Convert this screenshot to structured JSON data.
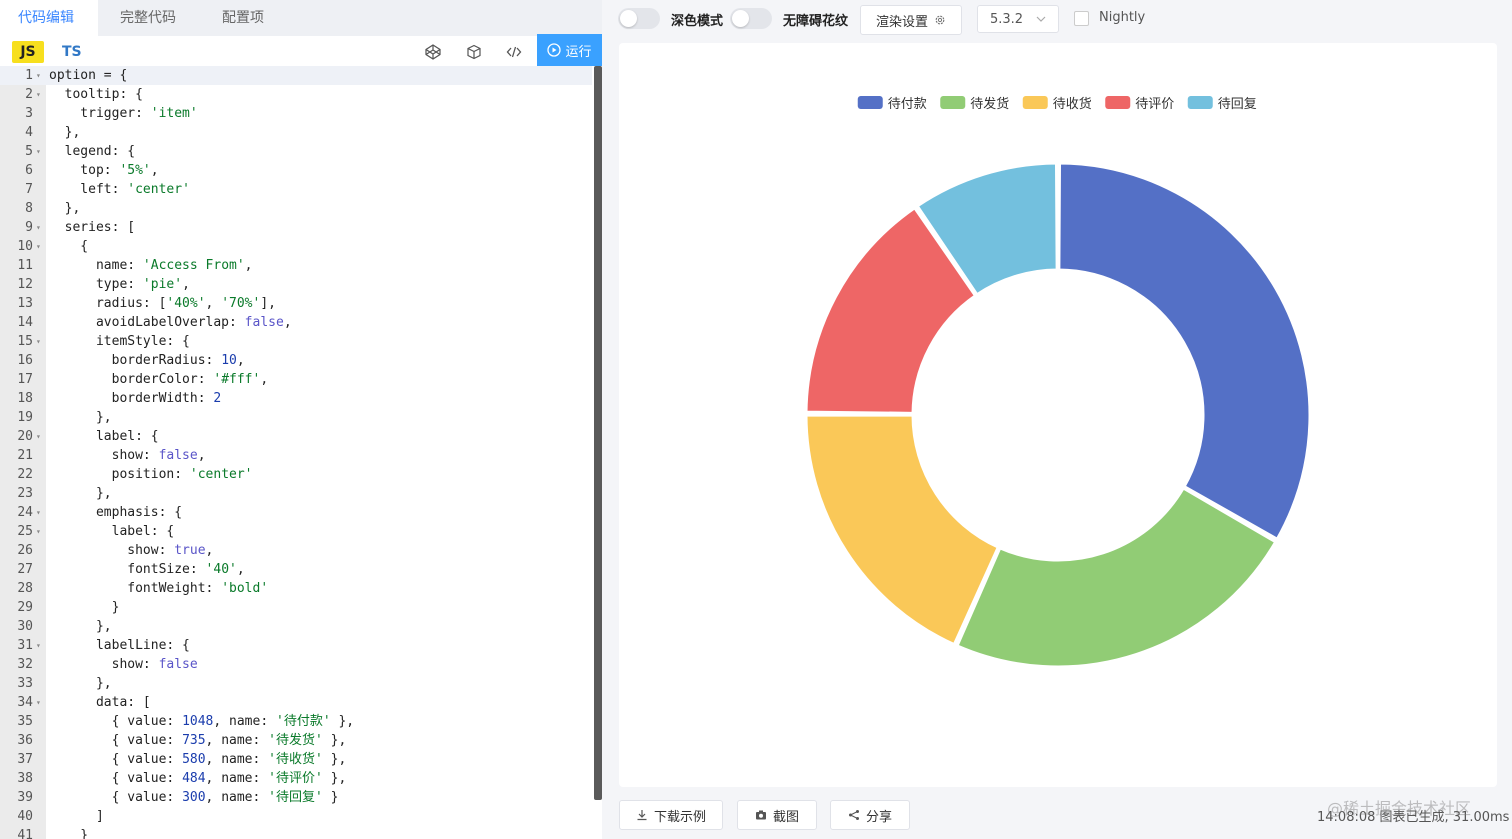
{
  "editor": {
    "tabs": [
      "代码编辑",
      "完整代码",
      "配置项"
    ],
    "lang_js": "JS",
    "lang_ts": "TS",
    "run_label": "运行",
    "lines": [
      [
        {
          "t": "option = {"
        }
      ],
      [
        {
          "t": "  tooltip: {"
        }
      ],
      [
        {
          "t": "    trigger: "
        },
        {
          "t": "'item'",
          "c": "str"
        }
      ],
      [
        {
          "t": "  },"
        }
      ],
      [
        {
          "t": "  legend: {"
        }
      ],
      [
        {
          "t": "    top: "
        },
        {
          "t": "'5%'",
          "c": "str"
        },
        {
          "t": ","
        }
      ],
      [
        {
          "t": "    left: "
        },
        {
          "t": "'center'",
          "c": "str"
        }
      ],
      [
        {
          "t": "  },"
        }
      ],
      [
        {
          "t": "  series: ["
        }
      ],
      [
        {
          "t": "    {"
        }
      ],
      [
        {
          "t": "      name: "
        },
        {
          "t": "'Access From'",
          "c": "str"
        },
        {
          "t": ","
        }
      ],
      [
        {
          "t": "      type: "
        },
        {
          "t": "'pie'",
          "c": "str"
        },
        {
          "t": ","
        }
      ],
      [
        {
          "t": "      radius: ["
        },
        {
          "t": "'40%'",
          "c": "str"
        },
        {
          "t": ", "
        },
        {
          "t": "'70%'",
          "c": "str"
        },
        {
          "t": "],"
        }
      ],
      [
        {
          "t": "      avoidLabelOverlap: "
        },
        {
          "t": "false",
          "c": "kw"
        },
        {
          "t": ","
        }
      ],
      [
        {
          "t": "      itemStyle: {"
        }
      ],
      [
        {
          "t": "        borderRadius: "
        },
        {
          "t": "10",
          "c": "num"
        },
        {
          "t": ","
        }
      ],
      [
        {
          "t": "        borderColor: "
        },
        {
          "t": "'#fff'",
          "c": "str"
        },
        {
          "t": ","
        }
      ],
      [
        {
          "t": "        borderWidth: "
        },
        {
          "t": "2",
          "c": "num"
        }
      ],
      [
        {
          "t": "      },"
        }
      ],
      [
        {
          "t": "      label: {"
        }
      ],
      [
        {
          "t": "        show: "
        },
        {
          "t": "false",
          "c": "kw"
        },
        {
          "t": ","
        }
      ],
      [
        {
          "t": "        position: "
        },
        {
          "t": "'center'",
          "c": "str"
        }
      ],
      [
        {
          "t": "      },"
        }
      ],
      [
        {
          "t": "      emphasis: {"
        }
      ],
      [
        {
          "t": "        label: {"
        }
      ],
      [
        {
          "t": "          show: "
        },
        {
          "t": "true",
          "c": "kw"
        },
        {
          "t": ","
        }
      ],
      [
        {
          "t": "          fontSize: "
        },
        {
          "t": "'40'",
          "c": "str"
        },
        {
          "t": ","
        }
      ],
      [
        {
          "t": "          fontWeight: "
        },
        {
          "t": "'bold'",
          "c": "str"
        }
      ],
      [
        {
          "t": "        }"
        }
      ],
      [
        {
          "t": "      },"
        }
      ],
      [
        {
          "t": "      labelLine: {"
        }
      ],
      [
        {
          "t": "        show: "
        },
        {
          "t": "false",
          "c": "kw"
        }
      ],
      [
        {
          "t": "      },"
        }
      ],
      [
        {
          "t": "      data: ["
        }
      ],
      [
        {
          "t": "        { value: "
        },
        {
          "t": "1048",
          "c": "num"
        },
        {
          "t": ", name: "
        },
        {
          "t": "'待付款'",
          "c": "str"
        },
        {
          "t": " },"
        }
      ],
      [
        {
          "t": "        { value: "
        },
        {
          "t": "735",
          "c": "num"
        },
        {
          "t": ", name: "
        },
        {
          "t": "'待发货'",
          "c": "str"
        },
        {
          "t": " },"
        }
      ],
      [
        {
          "t": "        { value: "
        },
        {
          "t": "580",
          "c": "num"
        },
        {
          "t": ", name: "
        },
        {
          "t": "'待收货'",
          "c": "str"
        },
        {
          "t": " },"
        }
      ],
      [
        {
          "t": "        { value: "
        },
        {
          "t": "484",
          "c": "num"
        },
        {
          "t": ", name: "
        },
        {
          "t": "'待评价'",
          "c": "str"
        },
        {
          "t": " },"
        }
      ],
      [
        {
          "t": "        { value: "
        },
        {
          "t": "300",
          "c": "num"
        },
        {
          "t": ", name: "
        },
        {
          "t": "'待回复'",
          "c": "str"
        },
        {
          "t": " }"
        }
      ],
      [
        {
          "t": "      ]"
        }
      ],
      [
        {
          "t": "    }"
        }
      ]
    ],
    "foldable_lines": [
      1,
      2,
      5,
      9,
      10,
      15,
      20,
      24,
      25,
      31,
      34
    ]
  },
  "preview": {
    "dark_mode_label": "深色模式",
    "accessible_label": "无障碍花纹",
    "render_settings_label": "渲染设置",
    "version": "5.3.2",
    "nightly_label": "Nightly",
    "download_label": "下载示例",
    "screenshot_label": "截图",
    "share_label": "分享",
    "status": "14:08:08   图表已生成, 31.00ms",
    "watermark": "@稀土掘金技术社区"
  },
  "chart_data": {
    "type": "pie",
    "series_name": "Access From",
    "radius": [
      "40%",
      "70%"
    ],
    "legend_position": "top-center",
    "categories": [
      "待付款",
      "待发货",
      "待收货",
      "待评价",
      "待回复"
    ],
    "values": [
      1048,
      735,
      580,
      484,
      300
    ],
    "colors": [
      "#5470c6",
      "#91cc75",
      "#fac858",
      "#ee6666",
      "#73c0de"
    ]
  }
}
